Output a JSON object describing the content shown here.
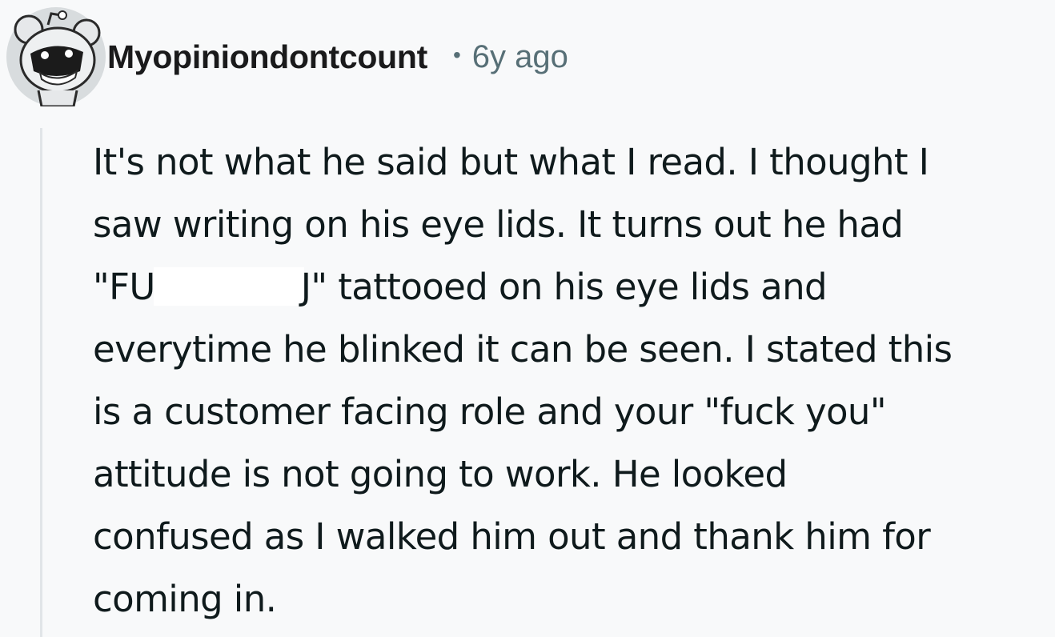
{
  "comment": {
    "author": "Myopiniondontcount",
    "separator": "•",
    "age": "6y ago",
    "avatar_icon": "snoo-avatar-icon",
    "body_lines": [
      "It's not what he said but what I read. I thought I",
      "saw writing on his eye lids. It turns out he had",
      {
        "before": "\"FU",
        "redacted": true,
        "after": "J\" tattooed on his eye lids and"
      },
      "everytime he blinked it can be seen. I stated this",
      "is a customer facing role and your \"fuck you\"",
      "attitude is not going to work. He looked",
      "confused as I walked him out and thank him for",
      "coming in."
    ]
  },
  "colors": {
    "background": "#f8f9fa",
    "text": "#0f1a1c",
    "meta": "#576f76",
    "thread_line": "#e1e5e8"
  }
}
